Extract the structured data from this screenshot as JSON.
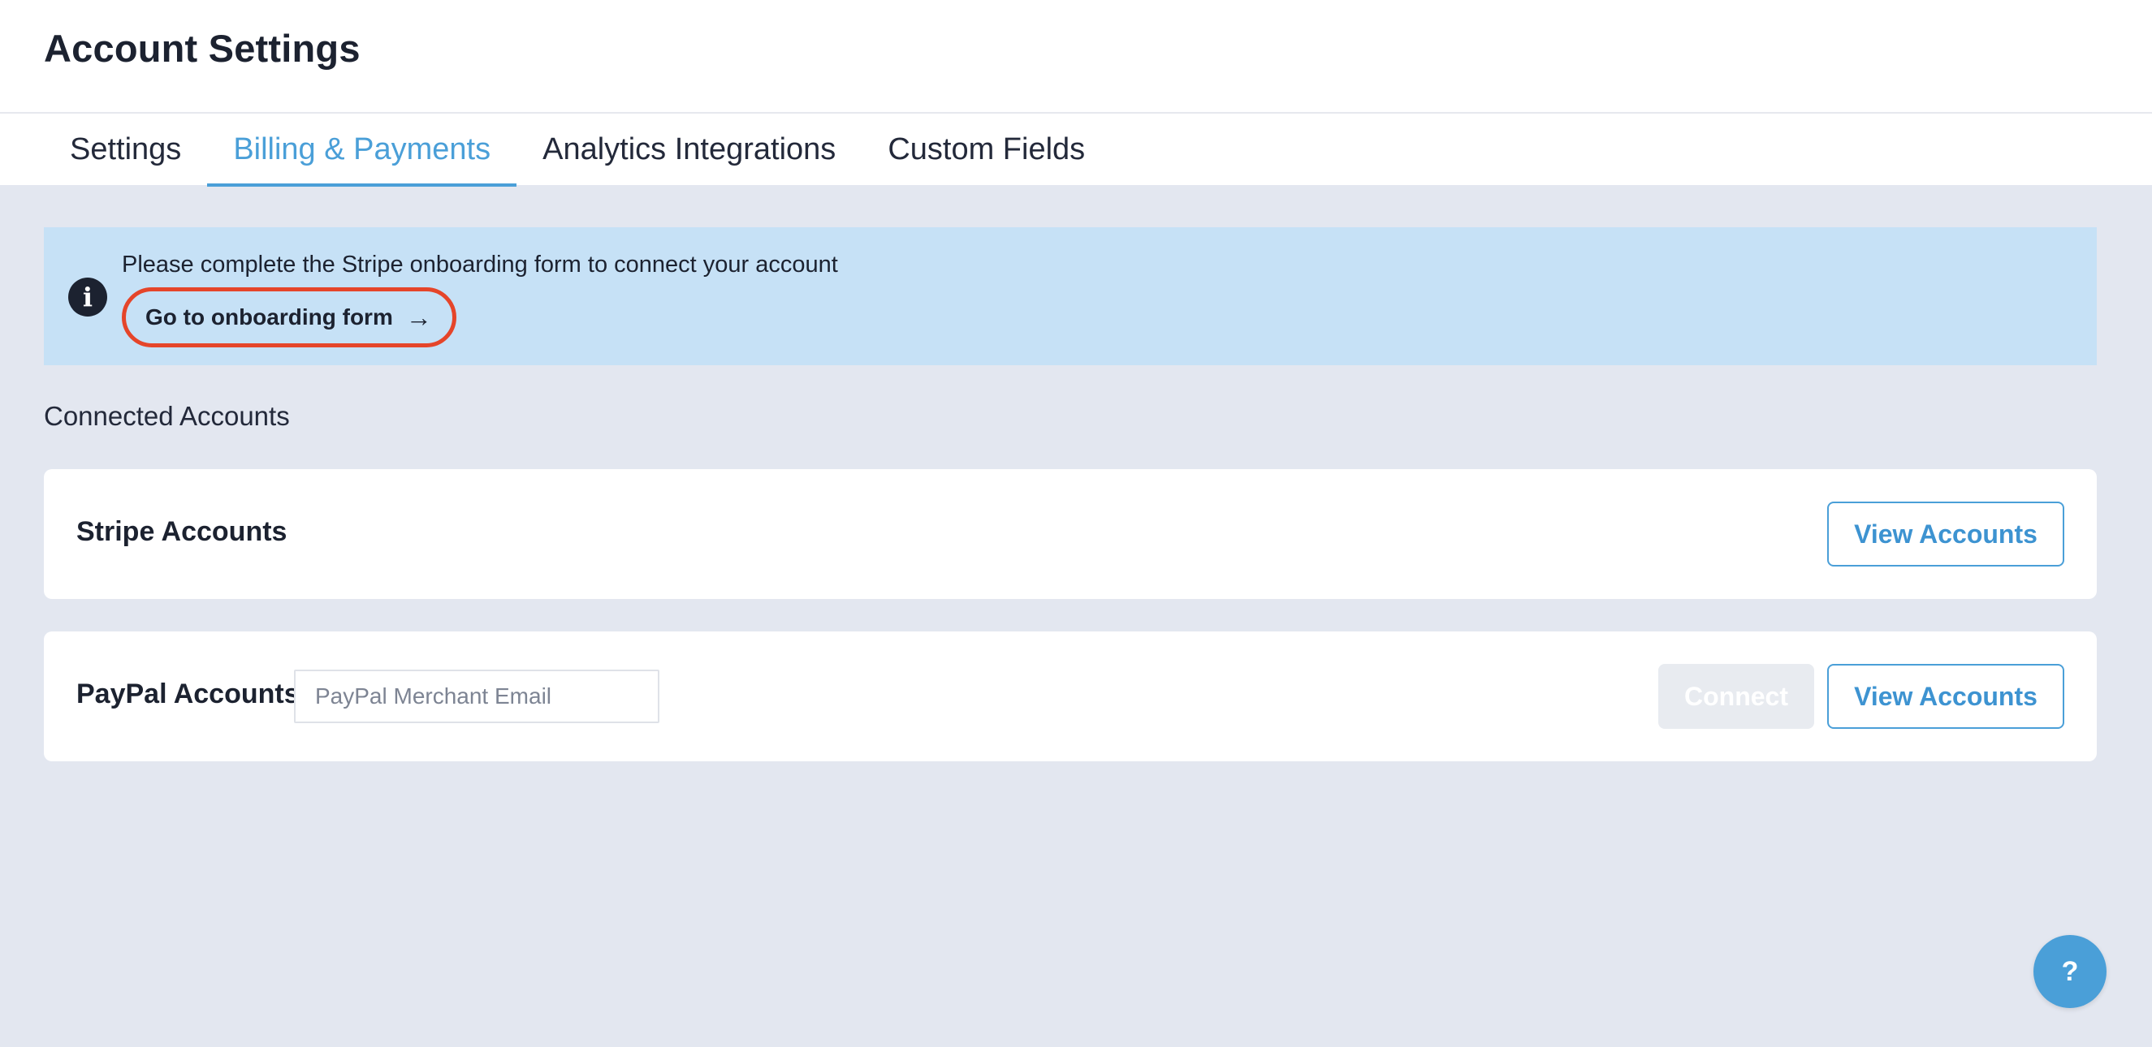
{
  "header": {
    "title": "Account Settings"
  },
  "tabs": [
    {
      "label": "Settings",
      "active": false
    },
    {
      "label": "Billing & Payments",
      "active": true
    },
    {
      "label": "Analytics Integrations",
      "active": false
    },
    {
      "label": "Custom Fields",
      "active": false
    }
  ],
  "banner": {
    "icon": "info-icon",
    "icon_glyph": "i",
    "message": "Please complete the Stripe onboarding form to connect your account",
    "link_label": "Go to onboarding form",
    "link_arrow": "→"
  },
  "connected_accounts": {
    "section_title": "Connected Accounts",
    "stripe": {
      "label": "Stripe Accounts",
      "view_button": "View Accounts"
    },
    "paypal": {
      "label": "PayPal Accounts",
      "email_placeholder": "PayPal Merchant Email",
      "email_value": "",
      "connect_button": "Connect",
      "view_button": "View Accounts"
    }
  },
  "help": {
    "icon": "help-icon",
    "label": "?"
  },
  "colors": {
    "accent": "#4a9fd8",
    "banner_bg": "#c6e1f6",
    "page_bg": "#e3e7f0",
    "highlight_outline": "#e5452a"
  }
}
